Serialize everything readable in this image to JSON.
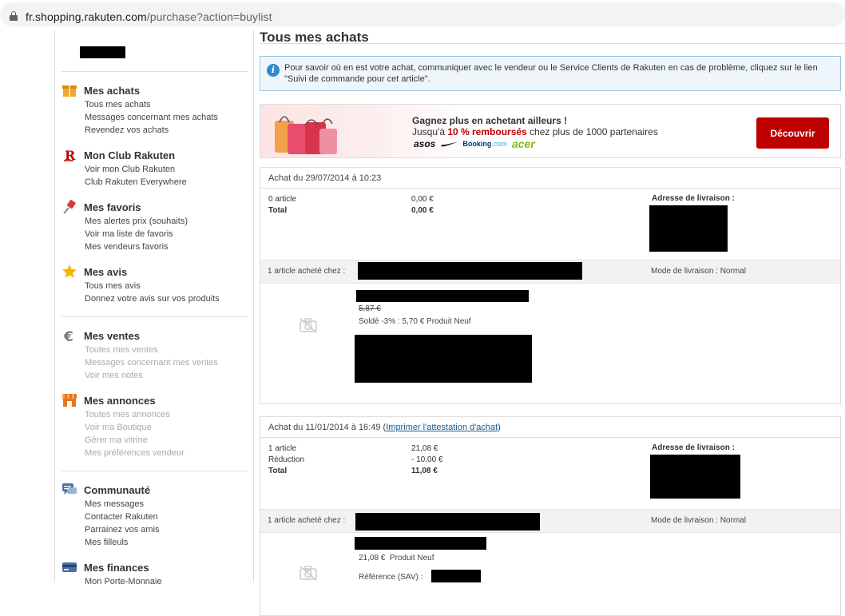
{
  "browser": {
    "url_host": "fr.shopping.rakuten.com",
    "url_path": "/purchase?action=buylist"
  },
  "sidebar": {
    "sections": [
      {
        "title": "Mes achats",
        "icon": "shopping-box-icon",
        "links": [
          "Tous mes achats",
          "Messages concernant mes achats",
          "Revendez vos achats"
        ]
      },
      {
        "title": "Mon Club Rakuten",
        "icon": "rakuten-r-icon",
        "links": [
          "Voir mon Club Rakuten",
          "Club Rakuten Everywhere"
        ]
      },
      {
        "title": "Mes favoris",
        "icon": "pin-icon",
        "links": [
          "Mes alertes prix (souhaits)",
          "Voir ma liste de favoris",
          "Mes vendeurs favoris"
        ]
      },
      {
        "title": "Mes avis",
        "icon": "star-icon",
        "links": [
          "Tous mes avis",
          "Donnez votre avis sur vos produits"
        ]
      },
      {
        "title": "Mes ventes",
        "icon": "euro-icon",
        "links": [
          "Toutes mes ventes",
          "Messages concernant mes ventes",
          "Voir mes notes"
        ]
      },
      {
        "title": "Mes annonces",
        "icon": "shop-icon",
        "links": [
          "Toutes mes annonces",
          "Voir ma Boutique",
          "Gérer ma vitrine",
          "Mes préférences vendeur"
        ]
      },
      {
        "title": "Communauté",
        "icon": "chat-icon",
        "links": [
          "Mes messages",
          "Contacter Rakuten",
          "Parrainez vos amis",
          "Mes filleuls"
        ]
      },
      {
        "title": "Mes finances",
        "icon": "card-icon",
        "links": [
          "Mon Porte-Monnaie"
        ]
      }
    ]
  },
  "main": {
    "title": "Tous mes achats",
    "info": "Pour savoir où en est votre achat, communiquer avec le vendeur ou le Service Clients de Rakuten en cas de problème, cliquez sur le lien \"Suivi de commande pour cet article\".",
    "promo": {
      "headline": "Gagnez plus en achetant ailleurs !",
      "sub_prefix": "Jusqu'à ",
      "sub_highlight": "10 % remboursés",
      "sub_suffix": " chez plus de 1000 partenaires",
      "brands": {
        "asos": "asos",
        "booking_a": "Booking",
        "booking_b": ".com",
        "acer": "acer"
      },
      "button": "Découvrir",
      "accent_color": "#bf0000"
    },
    "orders": [
      {
        "date": "Achat du 29/07/2014 à 10:23",
        "print_link": "",
        "lines": [
          {
            "label": "0 article",
            "value": "0,00 €",
            "bold": false
          },
          {
            "label": "Total",
            "value": "0,00 €",
            "bold": true
          }
        ],
        "address_label": "Adresse de livraison :",
        "seller_label": "1 article acheté chez :",
        "delivery": "Mode de livraison : Normal",
        "item": {
          "old_price": "5,87 €",
          "price_line": "Soldé -3% : 5,70 € Produit Neuf"
        }
      },
      {
        "date": "Achat du 11/01/2014 à 16:49",
        "print_link": "Imprimer l'attestation d'achat",
        "lines": [
          {
            "label": "1 article",
            "value": "21,08 €",
            "bold": false
          },
          {
            "label": "Réduction",
            "value": "- 10,00 €",
            "bold": false
          },
          {
            "label": "Total",
            "value": "11,08 €",
            "bold": true
          }
        ],
        "address_label": "Adresse de livraison :",
        "seller_label": "1 article acheté chez :",
        "delivery": "Mode de livraison : Normal",
        "item": {
          "price_line": "21,08 €  Produit Neuf",
          "ref_label": "Référence (SAV) :"
        }
      }
    ]
  }
}
